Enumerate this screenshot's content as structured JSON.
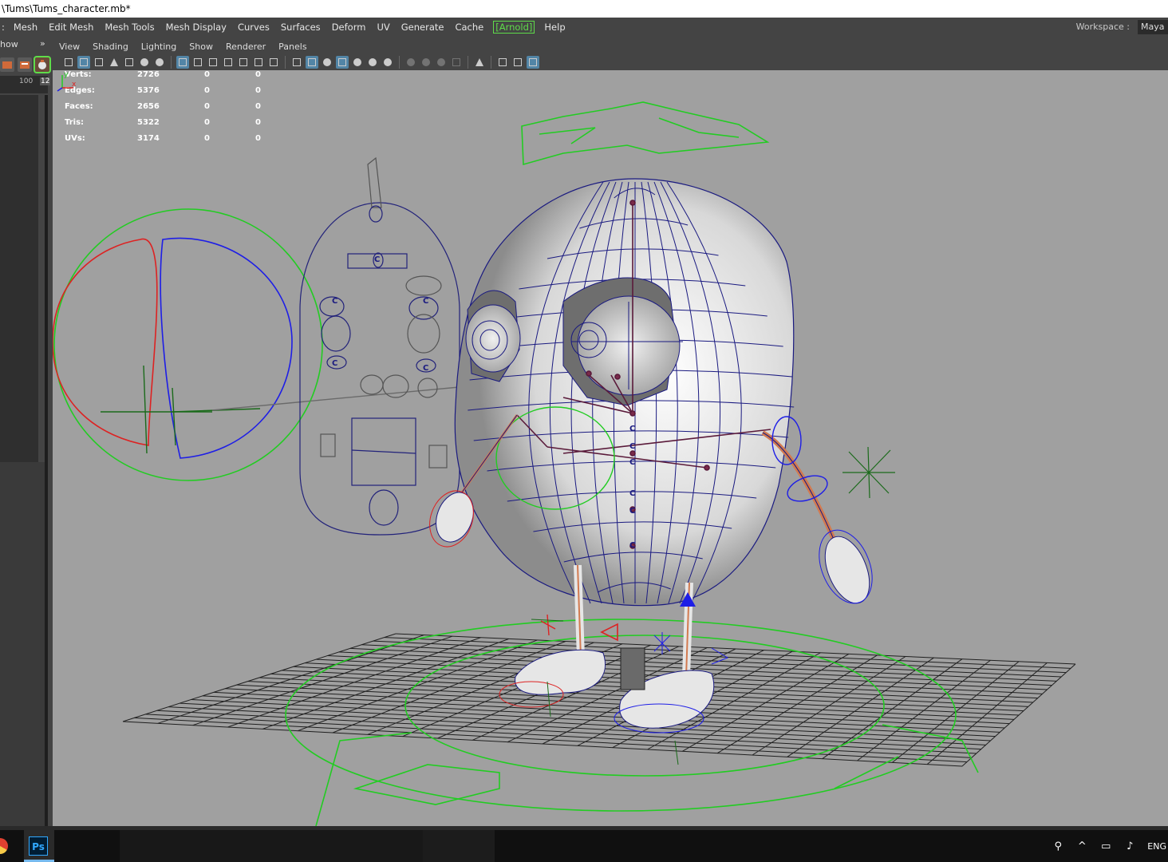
{
  "window": {
    "title": "\\Tums\\Tums_character.mb*"
  },
  "menubar": {
    "items": [
      "Mesh",
      "Edit Mesh",
      "Mesh Tools",
      "Mesh Display",
      "Curves",
      "Surfaces",
      "Deform",
      "UV",
      "Generate",
      "Cache",
      "[Arnold]",
      "Help"
    ],
    "leading_item": ":",
    "workspace_label": "Workspace :",
    "workspace_value": "Maya C"
  },
  "left_panel": {
    "show_tab": "how",
    "double_arrow": "»",
    "timeline_start": "100",
    "timeline_current": "12"
  },
  "panel_menu": {
    "items": [
      "View",
      "Shading",
      "Lighting",
      "Show",
      "Renderer",
      "Panels"
    ]
  },
  "hud": {
    "rows": [
      {
        "label": "Verts:",
        "value": "2726",
        "sel": "0",
        "uv": "0"
      },
      {
        "label": "Edges:",
        "value": "5376",
        "sel": "0",
        "uv": "0"
      },
      {
        "label": "Faces:",
        "value": "2656",
        "sel": "0",
        "uv": "0"
      },
      {
        "label": "Tris:",
        "value": "5322",
        "sel": "0",
        "uv": "0"
      },
      {
        "label": "UVs:",
        "value": "3174",
        "sel": "0",
        "uv": "0"
      }
    ]
  },
  "axis": {
    "y": "y",
    "x": "x"
  },
  "taskbar": {
    "ps_label": "Ps",
    "lang": "ENG"
  },
  "colors": {
    "viewport_bg": "#a0a0a0",
    "grid": "#1f1f1f",
    "wire": "#1a1a80",
    "ctrl_green": "#22cc22",
    "ctrl_red": "#dd2222",
    "ctrl_blue": "#1e1ee6",
    "accent_arnold": "#5fdc4a"
  }
}
